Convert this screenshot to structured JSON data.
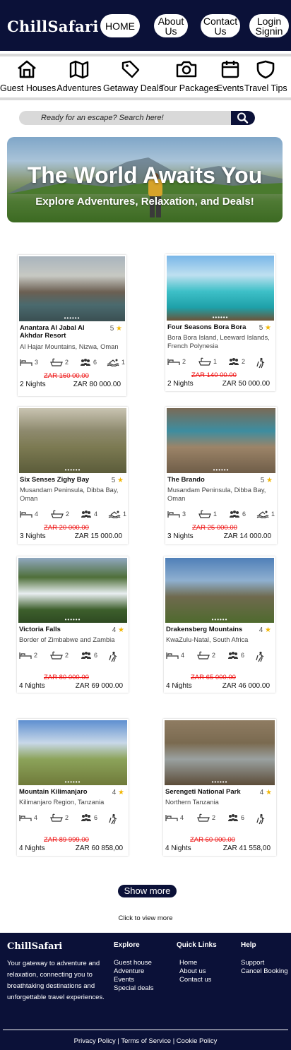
{
  "header": {
    "logo": "ChillSafari",
    "nav": [
      "HOME",
      "About Us",
      "Contact Us",
      "Login Signin"
    ]
  },
  "categories": [
    "Guest Houses",
    "Adventures",
    "Getaway Deals",
    "Tour Packages",
    "Events",
    "Travel Tips"
  ],
  "search": {
    "placeholder": "Ready for an escape? Search here!"
  },
  "hero": {
    "title": "The World Awaits You",
    "subtitle": "Explore Adventures, Relaxation, and Deals!"
  },
  "listings": [
    {
      "name": "Anantara Al Jabal Al Akhdar Resort",
      "rating": "5",
      "location": "Al Hajar Mountains, Nizwa, Oman",
      "beds": "3",
      "baths": "2",
      "guests": "6",
      "extra": "1",
      "old_price": "ZAR 160 00.00",
      "nights": "2 Nights",
      "price": "ZAR 80 000.00"
    },
    {
      "name": "Four Seasons Bora Bora",
      "rating": "5",
      "location": "Bora Bora Island, Leeward Islands, French Polynesia",
      "beds": "2",
      "baths": "1",
      "guests": "2",
      "extra": "",
      "old_price": "ZAR 140 00.00",
      "nights": "2 Nights",
      "price": "ZAR 50 000.00"
    },
    {
      "name": "Six Senses Zighy Bay",
      "rating": "5",
      "location": "Musandam Peninsula, Dibba Bay, Oman",
      "beds": "4",
      "baths": "2",
      "guests": "4",
      "extra": "1",
      "old_price": "ZAR 20 000.00",
      "nights": "3 Nights",
      "price": "ZAR 15 000.00"
    },
    {
      "name": "The Brando",
      "rating": "5",
      "location": "Musandam Peninsula, Dibba Bay, Oman",
      "beds": "3",
      "baths": "1",
      "guests": "6",
      "extra": "1",
      "old_price": "ZAR 25 000.00",
      "nights": "3 Nights",
      "price": "ZAR 14 000.00"
    },
    {
      "name": "Victoria Falls",
      "rating": "4",
      "location": "Border of Zimbabwe and Zambia",
      "beds": "2",
      "baths": "2",
      "guests": "6",
      "extra": "",
      "old_price": "ZAR 80 000.00",
      "nights": "4 Nights",
      "price": "ZAR 69 000.00"
    },
    {
      "name": "Drakensberg Mountains",
      "rating": "4",
      "location": "KwaZulu-Natal, South Africa",
      "beds": "4",
      "baths": "2",
      "guests": "6",
      "extra": "",
      "old_price": "ZAR 65 000.00",
      "nights": "4 Nights",
      "price": "ZAR 46 000.00"
    },
    {
      "name": "Mountain Kilimanjaro",
      "rating": "4",
      "location": "Kilimanjaro Region, Tanzania",
      "beds": "4",
      "baths": "2",
      "guests": "6",
      "extra": "",
      "old_price": "ZAR 89 999.00",
      "nights": "4 Nights",
      "price": "ZAR 60 858,00"
    },
    {
      "name": "Serengeti National Park",
      "rating": "4",
      "location": "Northern Tanzania",
      "beds": "4",
      "baths": "2",
      "guests": "6",
      "extra": "",
      "old_price": "ZAR 60 000.00",
      "nights": "4 Nights",
      "price": "ZAR 41 558,00"
    }
  ],
  "dots": "••••••",
  "show_more": "Show more",
  "click_to_view": "Click to view more",
  "footer": {
    "logo": "ChillSafari",
    "tagline": "Your gateway to adventure and relaxation, connecting you to breathtaking destinations and unforgettable travel experiences.",
    "explore_title": "Explore",
    "explore": [
      "Guest house",
      "Adventure",
      "Events",
      "Special deals"
    ],
    "quick_title": "Quick Links",
    "quick": [
      "Home",
      "About us",
      "Contact us"
    ],
    "help_title": "Help",
    "help": [
      "Support",
      "Cancel Booking"
    ],
    "legal": "Privacy Policy | Terms of Service | Cookie Policy"
  },
  "colors": {
    "navy": "#0b1138",
    "old_price": "#e11111",
    "star": "#f2b705"
  }
}
